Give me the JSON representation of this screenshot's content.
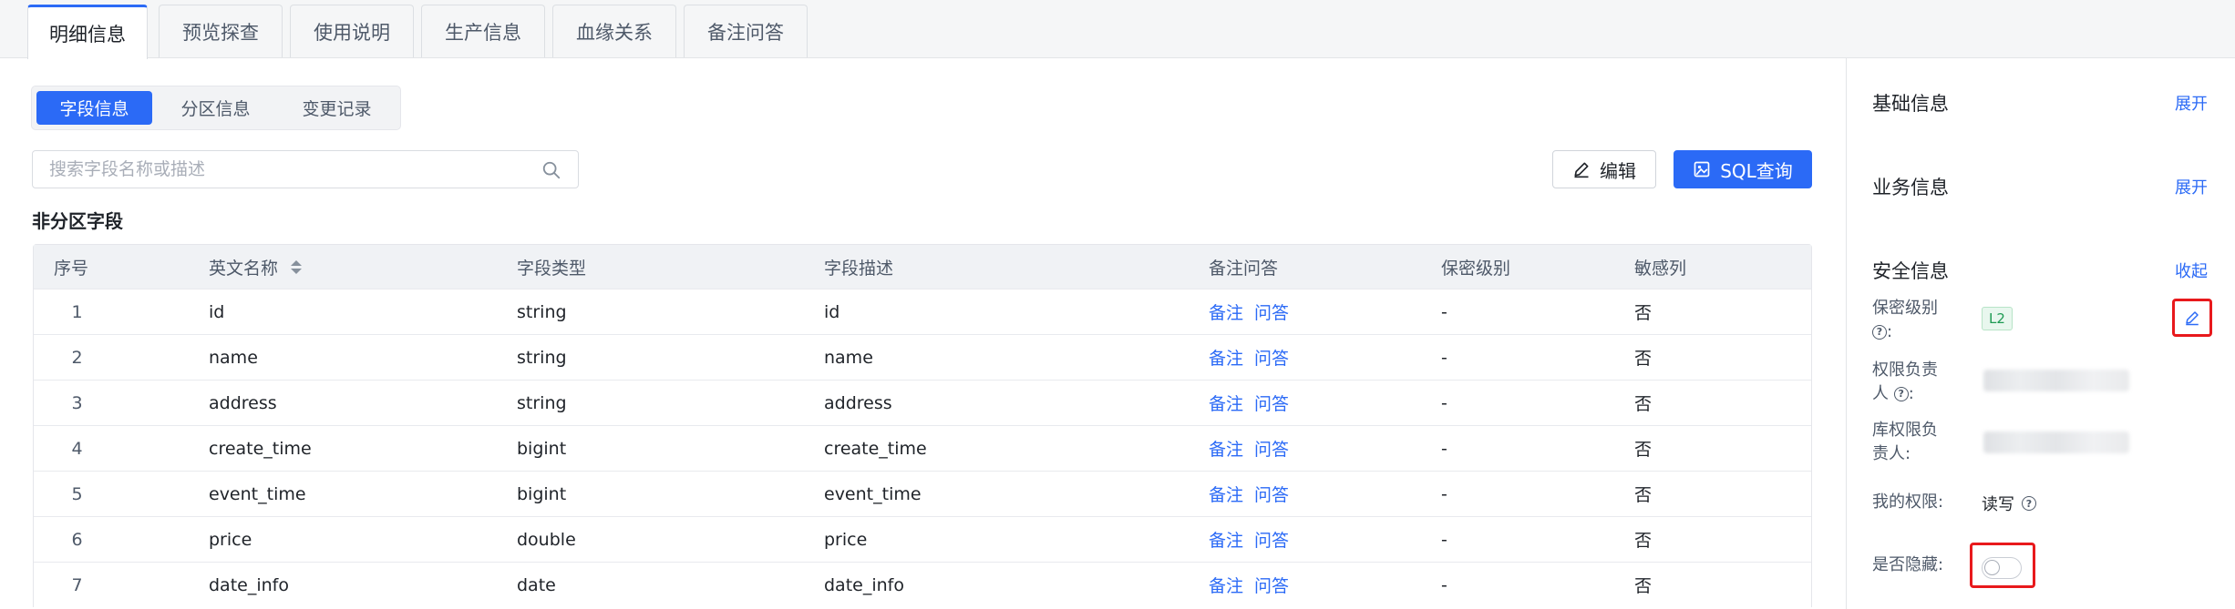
{
  "top_tabs": [
    "明细信息",
    "预览探查",
    "使用说明",
    "生产信息",
    "血缘关系",
    "备注问答"
  ],
  "sub_tabs": [
    "字段信息",
    "分区信息",
    "变更记录"
  ],
  "search": {
    "placeholder": "搜索字段名称或描述"
  },
  "toolbar": {
    "edit_label": "编辑",
    "sql_label": "SQL查询"
  },
  "section_title": "非分区字段",
  "table": {
    "headers": [
      "序号",
      "英文名称",
      "字段类型",
      "字段描述",
      "备注问答",
      "保密级别",
      "敏感列"
    ],
    "rows": [
      {
        "idx": "1",
        "name": "id",
        "type": "string",
        "desc": "id",
        "note": "备注",
        "qa": "问答",
        "sec": "-",
        "sens": "否"
      },
      {
        "idx": "2",
        "name": "name",
        "type": "string",
        "desc": "name",
        "note": "备注",
        "qa": "问答",
        "sec": "-",
        "sens": "否"
      },
      {
        "idx": "3",
        "name": "address",
        "type": "string",
        "desc": "address",
        "note": "备注",
        "qa": "问答",
        "sec": "-",
        "sens": "否"
      },
      {
        "idx": "4",
        "name": "create_time",
        "type": "bigint",
        "desc": "create_time",
        "note": "备注",
        "qa": "问答",
        "sec": "-",
        "sens": "否"
      },
      {
        "idx": "5",
        "name": "event_time",
        "type": "bigint",
        "desc": "event_time",
        "note": "备注",
        "qa": "问答",
        "sec": "-",
        "sens": "否"
      },
      {
        "idx": "6",
        "name": "price",
        "type": "double",
        "desc": "price",
        "note": "备注",
        "qa": "问答",
        "sec": "-",
        "sens": "否"
      },
      {
        "idx": "7",
        "name": "date_info",
        "type": "date",
        "desc": "date_info",
        "note": "备注",
        "qa": "问答",
        "sec": "-",
        "sens": "否"
      }
    ]
  },
  "right_panel": {
    "basic": {
      "title": "基础信息",
      "action": "展开"
    },
    "business": {
      "title": "业务信息",
      "action": "展开"
    },
    "security": {
      "title": "安全信息",
      "action": "收起"
    },
    "fields": {
      "secret_level_label": "保密级别",
      "secret_level_value": "L2",
      "perm_owner_label_1": "权限负责",
      "perm_owner_label_2": "人",
      "db_owner_label_1": "库权限负",
      "db_owner_label_2": "责人:",
      "my_perm_label": "我的权限:",
      "my_perm_value": "读写",
      "hidden_label": "是否隐藏:"
    },
    "hidden_toggle_on": false
  },
  "colors": {
    "accent": "#2b6af6",
    "highlight": "#e8191c"
  }
}
